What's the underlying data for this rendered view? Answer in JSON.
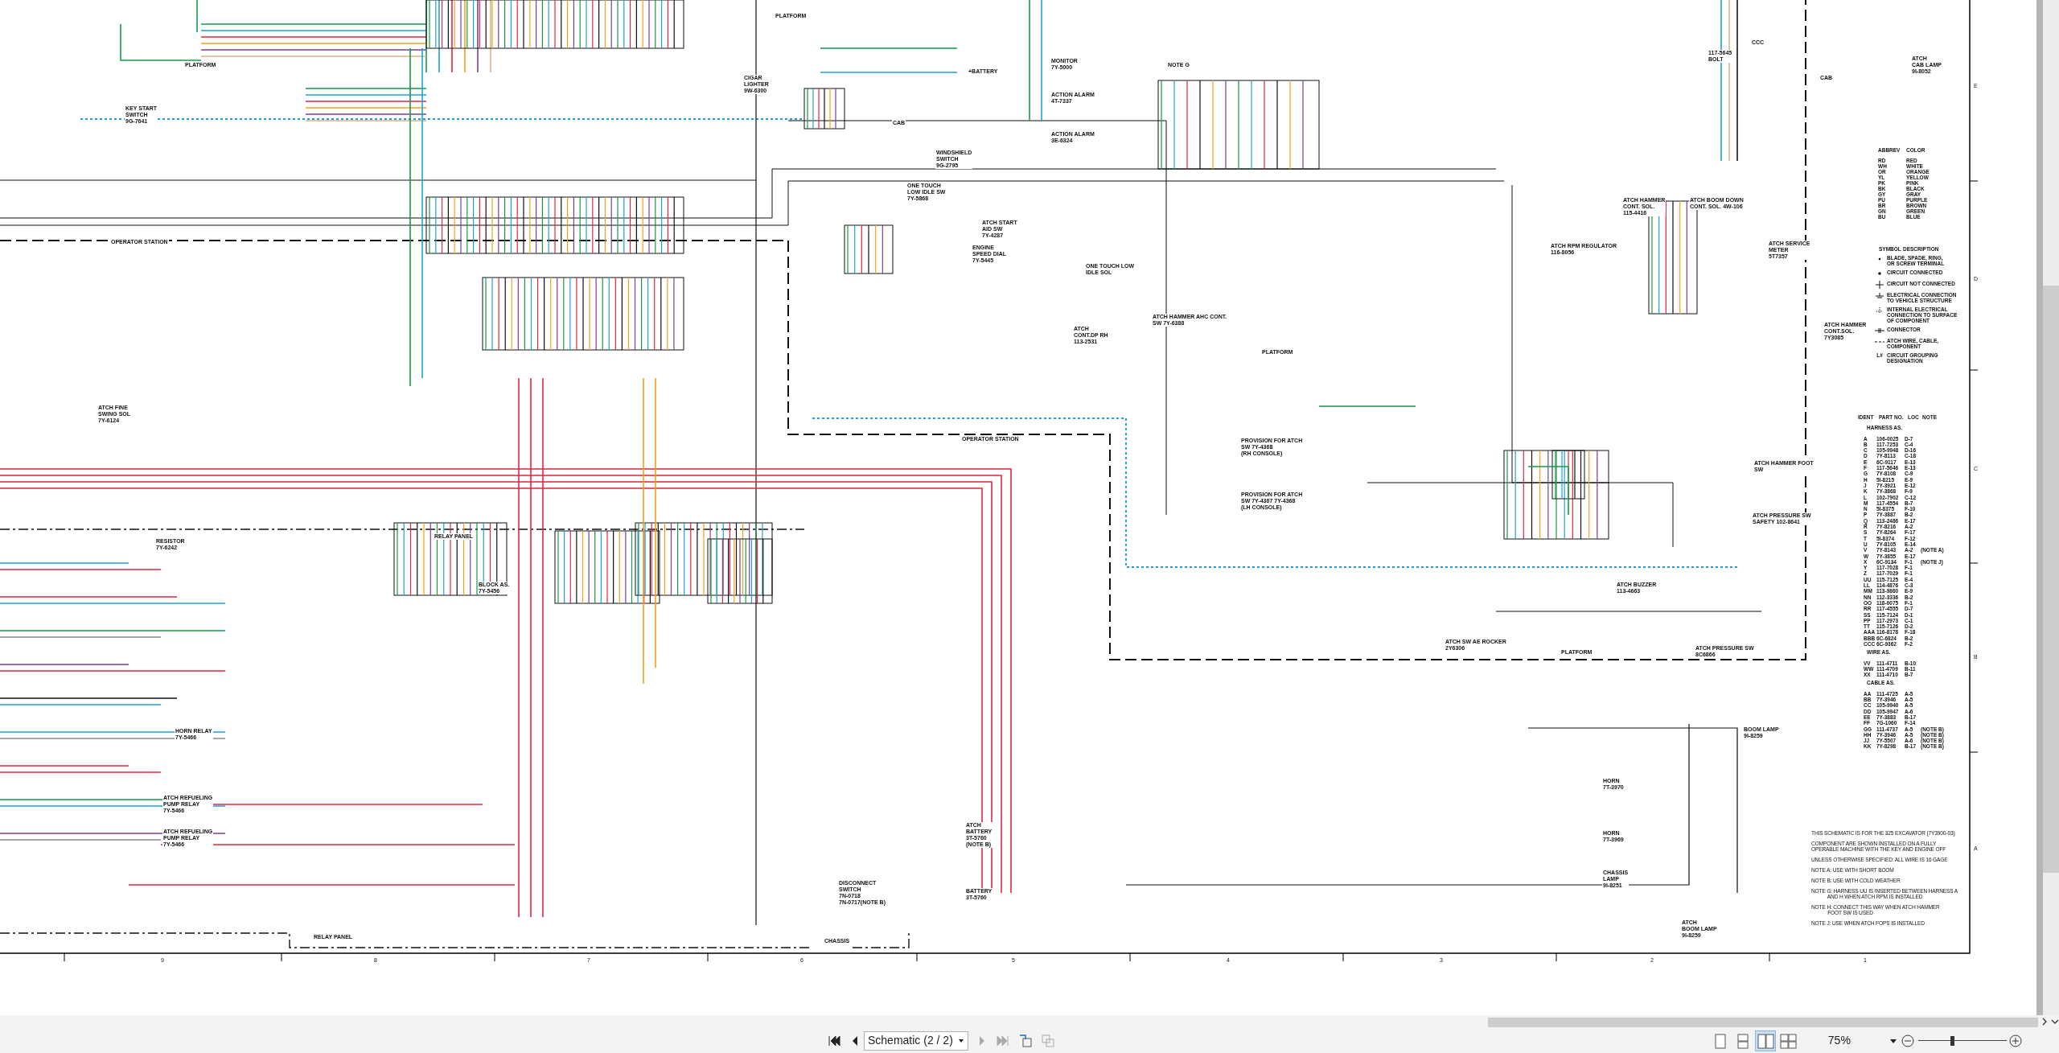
{
  "schematic": {
    "zone_numbers": [
      "9",
      "8",
      "7",
      "6",
      "5",
      "4",
      "3",
      "2",
      "1"
    ],
    "zone_letters": [
      "E",
      "D",
      "C",
      "B",
      "A"
    ],
    "components": [
      {
        "label": "PLATFORM"
      },
      {
        "label": "KEY START\nSWITCH\n9G-7641"
      },
      {
        "label": "OPERATOR STATION"
      },
      {
        "label": "ATCH FINE\nSWING SOL\n7Y-6124"
      },
      {
        "label": "RESISTOR\n7Y-6242"
      },
      {
        "label": "RELAY PANEL"
      },
      {
        "label": "HORN RELAY\n7Y-5466"
      },
      {
        "label": "ATCH REFUELING\nPUMP RELAY\n7Y-5466"
      },
      {
        "label": "ATCH REFUELING\nPUMP RELAY\n7Y-5466"
      },
      {
        "label": "RELAY PANEL"
      },
      {
        "label": "BLOCK AS.\n7Y-5456"
      },
      {
        "label": "CIGAR\nLIGHTER\n9W-6300"
      },
      {
        "label": "MONITOR\n7Y-5000"
      },
      {
        "label": "ACTION ALARM\n4T-7337"
      },
      {
        "label": "ACTION ALARM\n3E-6324"
      },
      {
        "label": "CAB"
      },
      {
        "label": "PLATFORM"
      },
      {
        "label": "+BATTERY"
      },
      {
        "label": "WINDSHIELD\nSWITCH\n9G-2795"
      },
      {
        "label": "ONE TOUCH\nLOW IDLE SW\n7Y-5868"
      },
      {
        "label": "ATCH START\nAID SW\n7Y-4287"
      },
      {
        "label": "ENGINE\nSPEED DIAL\n7Y-5445"
      },
      {
        "label": "ONE TOUCH LOW\nIDLE SOL"
      },
      {
        "label": "ATCH\nCONT.DP RH\n113-2531"
      },
      {
        "label": "ATCH HAMMER AHC CONT.\nSW 7Y-6388"
      },
      {
        "label": "PLATFORM"
      },
      {
        "label": "OPERATOR STATION"
      },
      {
        "label": "PROVISION FOR ATCH\nSW 7Y-4368\n(RH CONSOLE)"
      },
      {
        "label": "PROVISION FOR ATCH\nSW 7Y-4367 7Y-4368\n(LH CONSOLE)"
      },
      {
        "label": "ATCH RPM REGULATOR\n116-8056"
      },
      {
        "label": "ATCH HAMMER\nCONT. SOL.\n115-4416"
      },
      {
        "label": "ATCH BOOM DOWN\nCONT. SOL. 4W-106"
      },
      {
        "label": "ATCH SERVICE\nMETER\n5T7357"
      },
      {
        "label": "ATCH HAMMER\nCONT.SOL.\n7Y3085"
      },
      {
        "label": "ATCH HAMMER FOOT\nSW"
      },
      {
        "label": "ATCH PRESSURE SW\nSAFETY 102-8641"
      },
      {
        "label": "ATCH BUZZER\n113-4663"
      },
      {
        "label": "ATCH SW AE ROCKER\n2Y6306"
      },
      {
        "label": "PLATFORM"
      },
      {
        "label": "ATCH PRESSURE SW\n8C6866"
      },
      {
        "label": "BOOM LAMP\n9I-8259"
      },
      {
        "label": "HORN\n7T-3970"
      },
      {
        "label": "HORN\n7T-3969"
      },
      {
        "label": "CHASSIS\nLAMP\n9I-8251"
      },
      {
        "label": "ATCH\nBOOM LAMP\n9I-8259"
      },
      {
        "label": "DISCONNECT\nSWITCH\n7N-0718\n7N-0717(NOTE B)"
      },
      {
        "label": "ATCH\nBATTERY\n3T-5760\n(NOTE B)"
      },
      {
        "label": "BATTERY\n3T-5760"
      },
      {
        "label": "CHASSIS"
      },
      {
        "label": "ATCH\nCAB LAMP\n9I-8052"
      },
      {
        "label": "117-5645\nBOLT"
      },
      {
        "label": "NOTE G"
      },
      {
        "label": "CAB"
      },
      {
        "label": "CCC"
      }
    ],
    "color_legend": {
      "headers": [
        "ABBREV",
        "COLOR"
      ],
      "rows": [
        {
          "abbrev": "RD",
          "color_name": "RED"
        },
        {
          "abbrev": "WH",
          "color_name": "WHITE"
        },
        {
          "abbrev": "OR",
          "color_name": "ORANGE"
        },
        {
          "abbrev": "YL",
          "color_name": "YELLOW"
        },
        {
          "abbrev": "PK",
          "color_name": "PINK"
        },
        {
          "abbrev": "BK",
          "color_name": "BLACK"
        },
        {
          "abbrev": "GY",
          "color_name": "GRAY"
        },
        {
          "abbrev": "PU",
          "color_name": "PURPLE"
        },
        {
          "abbrev": "BR",
          "color_name": "BROWN"
        },
        {
          "abbrev": "GN",
          "color_name": "GREEN"
        },
        {
          "abbrev": "BU",
          "color_name": "BLUE"
        }
      ]
    },
    "symbol_legend": {
      "headers": [
        "SYMBOL",
        "DESCRIPTION"
      ],
      "rows": [
        {
          "kind": "terminal",
          "description": "BLADE, SPADE, RING,\nOR SCREW TERMINAL"
        },
        {
          "kind": "connected",
          "description": "CIRCUIT CONNECTED"
        },
        {
          "kind": "not_connected",
          "description": "CIRCUIT NOT CONNECTED"
        },
        {
          "kind": "ground",
          "description": "ELECTRICAL CONNECTION\nTO VEHICLE STRUCTURE"
        },
        {
          "kind": "internal",
          "description": "INTERNAL ELECTRICAL\nCONNECTION TO SURFACE\nOF COMPONENT"
        },
        {
          "kind": "connector",
          "description": "CONNECTOR"
        },
        {
          "kind": "dashed",
          "description": "ATCH WIRE, CABLE,\nCOMPONENT"
        },
        {
          "kind": "text",
          "symbol": "L#",
          "description": "CIRCUIT GROUPING\nDESIGNATION"
        }
      ]
    },
    "parts": {
      "headers": [
        "IDENT",
        "PART NO.",
        "LOC",
        "NOTE"
      ],
      "sections": [
        {
          "title": "HARNESS AS.",
          "rows": [
            {
              "ident": "A",
              "part_no": "106-0025",
              "loc": "D-7"
            },
            {
              "ident": "B",
              "part_no": "117-7253",
              "loc": "C-4"
            },
            {
              "ident": "C",
              "part_no": "105-9948",
              "loc": "D-16"
            },
            {
              "ident": "D",
              "part_no": "7Y-8113",
              "loc": "C-18"
            },
            {
              "ident": "E",
              "part_no": "6C-9117",
              "loc": "E-13"
            },
            {
              "ident": "F",
              "part_no": "117-5646",
              "loc": "E-13"
            },
            {
              "ident": "G",
              "part_no": "7Y-8108",
              "loc": "C-9"
            },
            {
              "ident": "H",
              "part_no": "5I-8215",
              "loc": "E-9"
            },
            {
              "ident": "J",
              "part_no": "7Y-3921",
              "loc": "E-12"
            },
            {
              "ident": "K",
              "part_no": "7Y-3868",
              "loc": "F-9"
            },
            {
              "ident": "L",
              "part_no": "102-7902",
              "loc": "C-12"
            },
            {
              "ident": "M",
              "part_no": "117-4554",
              "loc": "B-7"
            },
            {
              "ident": "N",
              "part_no": "5I-8375",
              "loc": "F-10"
            },
            {
              "ident": "P",
              "part_no": "7Y-3887",
              "loc": "B-2"
            },
            {
              "ident": "Q",
              "part_no": "113-2486",
              "loc": "E-17"
            },
            {
              "ident": "R",
              "part_no": "7Y-8216",
              "loc": "A-2"
            },
            {
              "ident": "S",
              "part_no": "7Y-8264",
              "loc": "F-17"
            },
            {
              "ident": "T",
              "part_no": "5I-8374",
              "loc": "F-12"
            },
            {
              "ident": "U",
              "part_no": "7Y-8105",
              "loc": "E-14"
            },
            {
              "ident": "V",
              "part_no": "7Y-8143",
              "loc": "A-2",
              "note": "(NOTE A)"
            },
            {
              "ident": "W",
              "part_no": "7Y-3855",
              "loc": "E-17"
            },
            {
              "ident": "X",
              "part_no": "6C-9134",
              "loc": "F-1",
              "note": "(NOTE J)"
            },
            {
              "ident": "Y",
              "part_no": "117-7028",
              "loc": "F-1"
            },
            {
              "ident": "Z",
              "part_no": "117-7029",
              "loc": "F-1"
            },
            {
              "ident": "UU",
              "part_no": "115-7125",
              "loc": "E-4"
            },
            {
              "ident": "LL",
              "part_no": "114-4876",
              "loc": "C-3"
            },
            {
              "ident": "MM",
              "part_no": "113-9860",
              "loc": "E-9"
            },
            {
              "ident": "NN",
              "part_no": "112-3336",
              "loc": "B-2"
            },
            {
              "ident": "OO",
              "part_no": "118-0075",
              "loc": "F-1"
            },
            {
              "ident": "RR",
              "part_no": "117-4555",
              "loc": "D-7"
            },
            {
              "ident": "SS",
              "part_no": "115-7124",
              "loc": "D-1"
            },
            {
              "ident": "PP",
              "part_no": "117-2973",
              "loc": "C-1"
            },
            {
              "ident": "TT",
              "part_no": "115-7126",
              "loc": "D-2"
            },
            {
              "ident": "AAA",
              "part_no": "116-8178",
              "loc": "F-18"
            },
            {
              "ident": "BBB",
              "part_no": "6C-6824",
              "loc": "B-2"
            },
            {
              "ident": "CCC",
              "part_no": "6C-9362",
              "loc": "F-2"
            }
          ]
        },
        {
          "title": "WIRE AS.",
          "rows": [
            {
              "ident": "VV",
              "part_no": "111-4711",
              "loc": "B-10"
            },
            {
              "ident": "WW",
              "part_no": "111-4709",
              "loc": "B-11"
            },
            {
              "ident": "XX",
              "part_no": "111-4710",
              "loc": "B-7"
            }
          ]
        },
        {
          "title": "CABLE AS.",
          "rows": [
            {
              "ident": "AA",
              "part_no": "111-4725",
              "loc": "A-5"
            },
            {
              "ident": "BB",
              "part_no": "7Y-3946",
              "loc": "A-5"
            },
            {
              "ident": "CC",
              "part_no": "105-9940",
              "loc": "A-5"
            },
            {
              "ident": "DD",
              "part_no": "105-9947",
              "loc": "A-6"
            },
            {
              "ident": "EE",
              "part_no": "7Y-3883",
              "loc": "B-17"
            },
            {
              "ident": "FF",
              "part_no": "7G-1060",
              "loc": "F-14"
            },
            {
              "ident": "GG",
              "part_no": "111-4737",
              "loc": "A-5",
              "note": "(NOTE B)"
            },
            {
              "ident": "HH",
              "part_no": "7Y-3946",
              "loc": "A-5",
              "note": "(NOTE B)"
            },
            {
              "ident": "JJ",
              "part_no": "7Y-5507",
              "loc": "A-6",
              "note": "(NOTE B)"
            },
            {
              "ident": "KK",
              "part_no": "7Y-8298",
              "loc": "B-17",
              "note": "(NOTE B)"
            }
          ]
        }
      ]
    },
    "notes": [
      "THIS SCHEMATIC IS FOR THE 325 EXCAVATOR (7Y3900-03)",
      "COMPONENT ARE SHOWN INSTALLED ON A FULLY\nOPERABLE MACHINE WITH THE KEY AND ENGINE OFF",
      "UNLESS OTHERWISE SPECIFIED: ALL WIRE IS 16 GAGE",
      "NOTE A: USE WITH SHORT BOOM",
      "NOTE B: USE WITH COLD WEATHER",
      "NOTE G: HARNESS UU IS INSERTED BETWEEN HARNESS A\n            AND H WHEN ATCH RPM IS INSTALLED",
      "NOTE H: CONNECT THIS WAY WHEN ATCH HAMMER\n            FOOT SW IS USED",
      "NOTE J: USE WHEN ATCH FOPS IS INSTALLED"
    ]
  },
  "viewer": {
    "page_selector": "Schematic (2 / 2)",
    "zoom": "75%",
    "zoom_slider": {
      "level": 0.38
    },
    "layout_buttons": [
      {
        "selected": false
      },
      {
        "selected": false
      },
      {
        "selected": true
      },
      {
        "selected": false
      }
    ]
  }
}
